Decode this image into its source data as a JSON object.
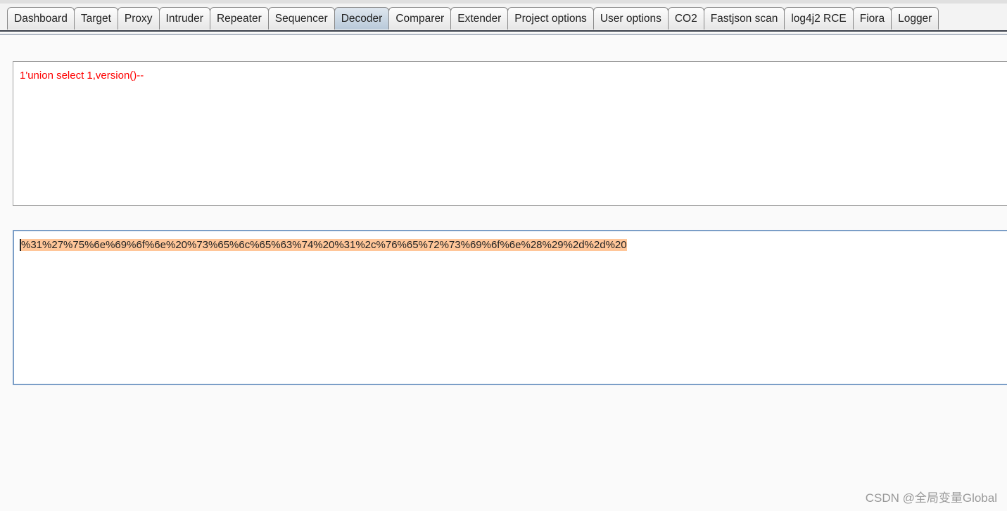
{
  "tabs": [
    "Dashboard",
    "Target",
    "Proxy",
    "Intruder",
    "Repeater",
    "Sequencer",
    "Decoder",
    "Comparer",
    "Extender",
    "Project options",
    "User options",
    "CO2",
    "Fastjson scan",
    "log4j2 RCE",
    "Fiora",
    "Logger"
  ],
  "active_tab": "Decoder",
  "decoder": {
    "input": "1'union select 1,version()--",
    "output": "%31%27%75%6e%69%6f%6e%20%73%65%6c%65%63%74%20%31%2c%76%65%72%73%69%6f%6e%28%29%2d%2d%20"
  },
  "watermark": "CSDN @全局变量Global",
  "colors": {
    "input_text": "#ff0000",
    "selection": "#ffc699"
  }
}
